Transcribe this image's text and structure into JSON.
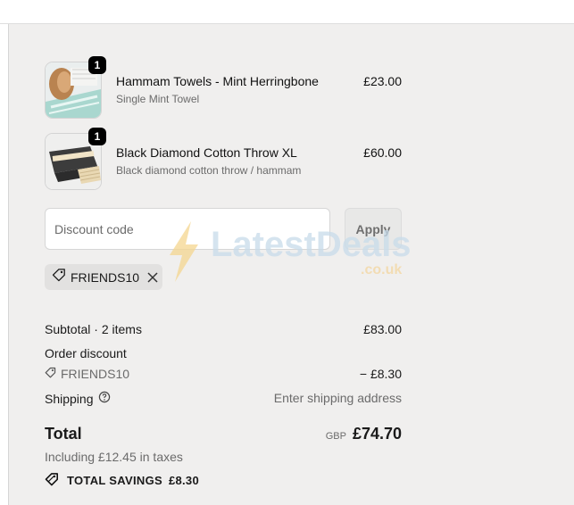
{
  "cart": {
    "items": [
      {
        "title": "Hammam Towels - Mint Herringbone",
        "variant": "Single Mint Towel",
        "price": "£23.00",
        "quantity": "1",
        "thumbnail": "mint-towel-image"
      },
      {
        "title": "Black Diamond Cotton Throw XL",
        "variant": "Black diamond cotton throw / hammam",
        "price": "£60.00",
        "quantity": "1",
        "thumbnail": "black-throw-image"
      }
    ]
  },
  "discount": {
    "placeholder": "Discount code",
    "value": "",
    "apply_label": "Apply",
    "applied_code": "FRIENDS10"
  },
  "summary": {
    "subtotal_label": "Subtotal · 2 items",
    "subtotal_value": "£83.00",
    "order_discount_label": "Order discount",
    "order_discount_code": "FRIENDS10",
    "order_discount_value": "− £8.30",
    "shipping_label": "Shipping",
    "shipping_value": "Enter shipping address",
    "total_label": "Total",
    "total_currency": "GBP",
    "total_value": "£74.70",
    "taxes_note": "Including £12.45 in taxes",
    "savings_label": "TOTAL SAVINGS",
    "savings_value": "£8.30"
  },
  "watermark": {
    "text": "LatestDeals",
    "sub": ".co.uk"
  },
  "colors": {
    "panel_bg": "#f0efee",
    "chip_bg": "#e2e1e0",
    "muted_text": "#6b6b6b",
    "badge_bg": "#000000"
  },
  "icons": [
    "tag-icon",
    "close-icon",
    "help-circle-icon",
    "savings-tag-icon",
    "lightning-icon"
  ]
}
